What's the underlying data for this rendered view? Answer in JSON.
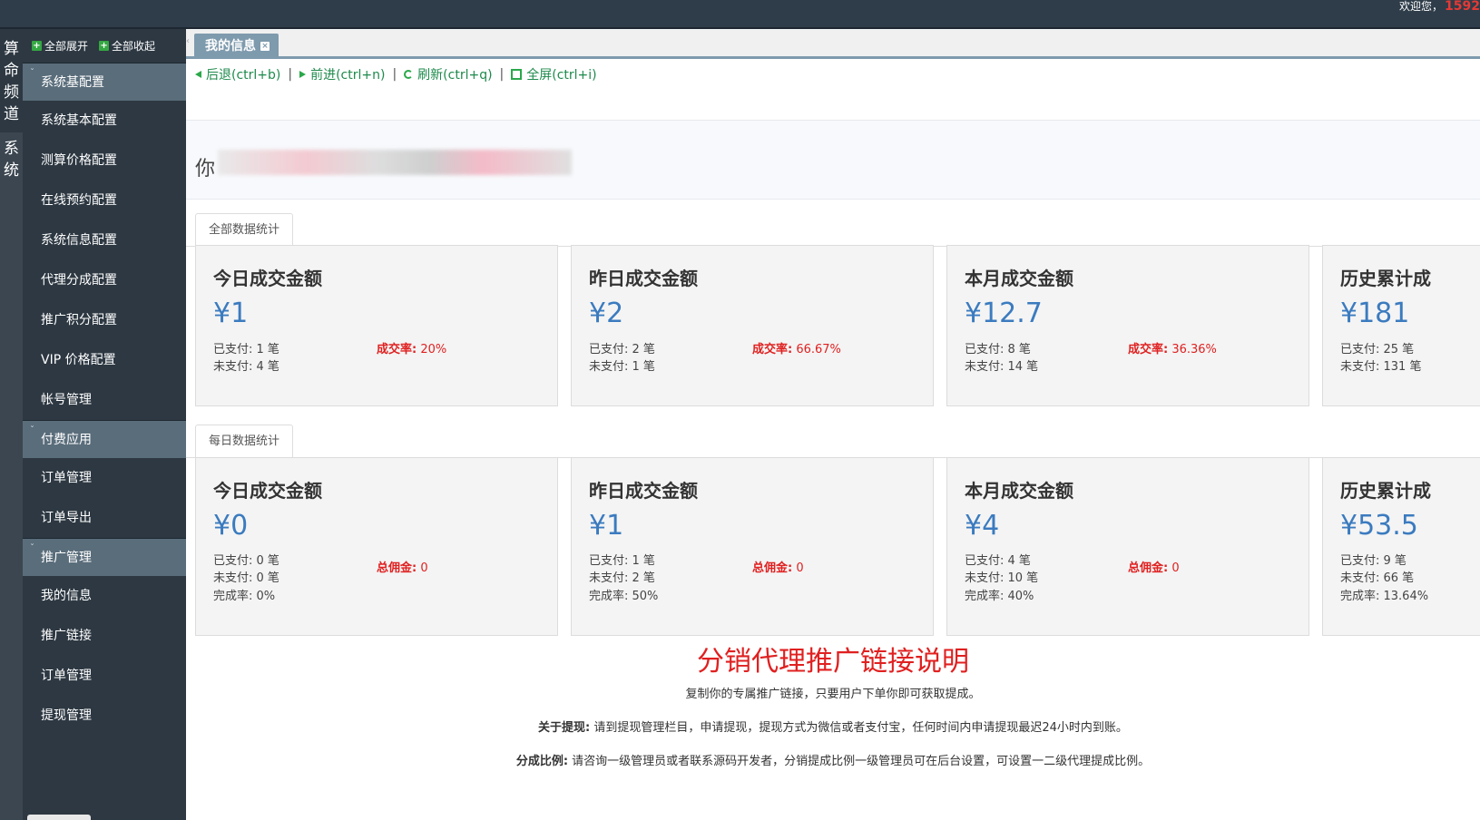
{
  "header": {
    "welcome_label": "欢迎您，",
    "user_name": "1592"
  },
  "categories": [
    "算命频道",
    "系统"
  ],
  "sidebar": {
    "expand_all": "全部展开",
    "collapse_all": "全部收起",
    "groups": [
      {
        "title": "系统基配置",
        "items": [
          "系统基本配置",
          "测算价格配置",
          "在线预约配置",
          "系统信息配置",
          "代理分成配置",
          "推广积分配置",
          "VIP 价格配置",
          "帐号管理"
        ]
      },
      {
        "title": "付费应用",
        "items": [
          "订单管理",
          "订单导出"
        ]
      },
      {
        "title": "推广管理",
        "items": [
          "我的信息",
          "推广链接",
          "订单管理",
          "提现管理"
        ]
      }
    ]
  },
  "tabbar": {
    "active_tab": "我的信息"
  },
  "navbar": {
    "back": "后退(ctrl+b)",
    "forward": "前进(ctrl+n)",
    "refresh": "刷新(ctrl+q)",
    "fullscreen": "全屏(ctrl+i)"
  },
  "greeting": {
    "text": "你"
  },
  "section_all": {
    "label": "全部数据统计",
    "cards": [
      {
        "title": "今日成交金额",
        "amount": "¥1",
        "paid": "已支付: 1 笔",
        "unpaid": "未支付: 4 笔",
        "rate_label": "成交率:",
        "rate_value": "20%"
      },
      {
        "title": "昨日成交金额",
        "amount": "¥2",
        "paid": "已支付: 2 笔",
        "unpaid": "未支付: 1 笔",
        "rate_label": "成交率:",
        "rate_value": "66.67%"
      },
      {
        "title": "本月成交金额",
        "amount": "¥12.7",
        "paid": "已支付: 8 笔",
        "unpaid": "未支付: 14 笔",
        "rate_label": "成交率:",
        "rate_value": "36.36%"
      },
      {
        "title": "历史累计成",
        "amount": "¥181",
        "paid": "已支付: 25 笔",
        "unpaid": "未支付: 131 笔",
        "rate_label": "",
        "rate_value": ""
      }
    ]
  },
  "section_daily": {
    "label": "每日数据统计",
    "cards": [
      {
        "title": "今日成交金额",
        "amount": "¥0",
        "paid": "已支付: 0 笔",
        "unpaid": "未支付: 0 笔",
        "completion": "完成率: 0%",
        "comm_label": "总佣金:",
        "comm_value": "0"
      },
      {
        "title": "昨日成交金额",
        "amount": "¥1",
        "paid": "已支付: 1 笔",
        "unpaid": "未支付: 2 笔",
        "completion": "完成率: 50%",
        "comm_label": "总佣金:",
        "comm_value": "0"
      },
      {
        "title": "本月成交金额",
        "amount": "¥4",
        "paid": "已支付: 4 笔",
        "unpaid": "未支付: 10 笔",
        "completion": "完成率: 40%",
        "comm_label": "总佣金:",
        "comm_value": "0"
      },
      {
        "title": "历史累计成",
        "amount": "¥53.5",
        "paid": "已支付: 9 笔",
        "unpaid": "未支付: 66 笔",
        "completion": "完成率: 13.64%",
        "comm_label": "",
        "comm_value": ""
      }
    ]
  },
  "description": {
    "title": "分销代理推广链接说明",
    "intro": "复制你的专属推广链接，只要用户下单你即可获取提成。",
    "withdraw_label": "关于提现:",
    "withdraw_text": "请到提现管理栏目，申请提现，提现方式为微信或者支付宝，任何时间内申请提现最迟24小时内到账。",
    "ratio_label": "分成比例:",
    "ratio_text": "请咨询一级管理员或者联系源码开发者，分销提成比例一级管理员可在后台设置，可设置一二级代理提成比例。"
  }
}
